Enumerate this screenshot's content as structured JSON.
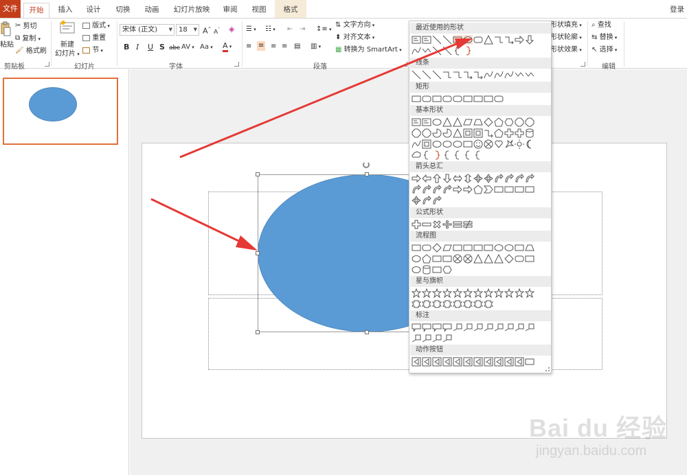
{
  "tabs": {
    "file": "文件",
    "home": "开始",
    "insert": "插入",
    "design": "设计",
    "transitions": "切换",
    "animations": "动画",
    "slideshow": "幻灯片放映",
    "review": "审阅",
    "view": "视图",
    "format": "格式",
    "login": "登录"
  },
  "clipboard": {
    "paste": "粘贴",
    "cut": "剪切",
    "copy": "复制",
    "format_painter": "格式刷",
    "group_label": "剪贴板"
  },
  "slides": {
    "new_slide_1": "新建",
    "new_slide_2": "幻灯片",
    "layout": "版式",
    "reset": "重置",
    "section": "节",
    "group_label": "幻灯片"
  },
  "font": {
    "family": "宋体 (正文)",
    "size": "18",
    "bold": "B",
    "italic": "I",
    "underline": "U",
    "shadow": "S",
    "strike": "abc",
    "spacing": "AV",
    "change_case": "Aa",
    "color": "A",
    "grow": "A",
    "shrink": "A",
    "group_label": "字体"
  },
  "paragraph": {
    "text_direction": "文字方向",
    "align_text": "对齐文本",
    "smartart": "转换为 SmartArt",
    "group_label": "段落"
  },
  "drawing": {
    "shape_fill": "形状填充",
    "shape_outline": "形状轮廓",
    "shape_effects": "形状效果"
  },
  "editing": {
    "find": "查找",
    "replace": "替换",
    "select": "选择",
    "group_label": "编辑"
  },
  "gallery": {
    "sections": [
      "最近使用的形状",
      "线条",
      "矩形",
      "基本形状",
      "箭头总汇",
      "公式形状",
      "流程图",
      "星与旗帜",
      "标注",
      "动作按钮"
    ]
  },
  "watermark": {
    "logo": "Bai du 经验",
    "url": "jingyan.baidu.com"
  },
  "colors": {
    "accent": "#c43e1c",
    "shape_fill": "#5b9bd5",
    "arrow": "#e53935",
    "format_tab": "#f6ebd8"
  }
}
